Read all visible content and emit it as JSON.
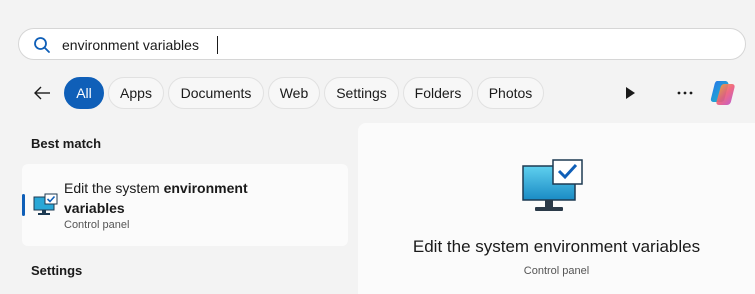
{
  "search": {
    "query": "environment variables"
  },
  "filters": [
    {
      "label": "All",
      "active": true
    },
    {
      "label": "Apps",
      "active": false
    },
    {
      "label": "Documents",
      "active": false
    },
    {
      "label": "Web",
      "active": false
    },
    {
      "label": "Settings",
      "active": false
    },
    {
      "label": "Folders",
      "active": false
    },
    {
      "label": "Photos",
      "active": false
    }
  ],
  "toolbar": {
    "more_label": "···"
  },
  "sections": {
    "best_match": "Best match",
    "settings": "Settings"
  },
  "best_match": {
    "title_prefix": "Edit the system ",
    "title_bold": "environment",
    "title_line2": "variables",
    "subtitle": "Control panel"
  },
  "preview": {
    "title": "Edit the system environment variables",
    "subtitle": "Control panel"
  },
  "colors": {
    "accent": "#0f5fb8",
    "background": "#f3f3f3"
  },
  "icons": [
    "search-icon",
    "back-arrow-icon",
    "play-icon",
    "more-icon",
    "copilot-icon",
    "monitor-checkbox-icon"
  ]
}
